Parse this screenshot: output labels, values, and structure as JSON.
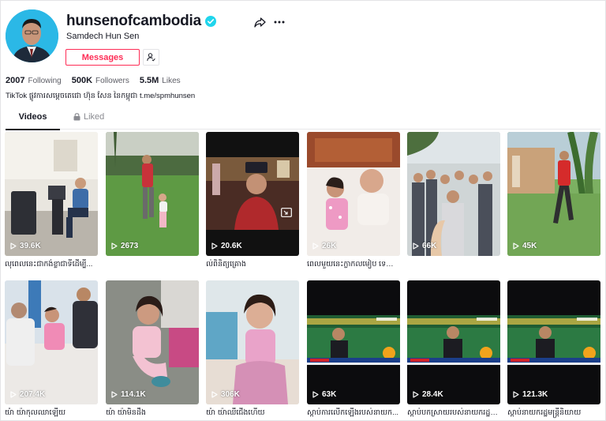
{
  "profile": {
    "username": "hunsenofcambodia",
    "display_name": "Samdech Hun Sen",
    "messages_label": "Messages",
    "bio": "TikTok ផ្លូវការសម្តេចតេជោ ហ៊ុន សែន នៃកម្ពុជា t.me/spmhunsen"
  },
  "stats": {
    "following": {
      "value": "2007",
      "label": "Following"
    },
    "followers": {
      "value": "500K",
      "label": "Followers"
    },
    "likes": {
      "value": "5.5M",
      "label": "Likes"
    }
  },
  "tabs": {
    "videos": "Videos",
    "liked": "Liked"
  },
  "videos": [
    {
      "views": "39.6K",
      "caption": "លុពេលនេះជាកង់ខ្លាជាទីដើម្បី..."
    },
    {
      "views": "2673",
      "caption": ""
    },
    {
      "views": "20.6K",
      "caption": "ល់ពិនិត្យគ្រោង"
    },
    {
      "views": "26K",
      "caption": "ពេលមួយនេះក្លាកលមៀប ទេស ពិតុ..."
    },
    {
      "views": "66K",
      "caption": ""
    },
    {
      "views": "45K",
      "caption": ""
    },
    {
      "views": "207.4K",
      "caption": "យ៉ា យ៉ាកុលឈាឡើយ"
    },
    {
      "views": "114.1K",
      "caption": "យ៉ា យ៉ាមិនដឹង"
    },
    {
      "views": "306K",
      "caption": "យ៉ា យ៉ាឈឺជើងហើយ"
    },
    {
      "views": "63K",
      "caption": "ស្តាប់ការលើកឡើងរបស់នាយក..."
    },
    {
      "views": "28.4K",
      "caption": "ស្តាប់បកស្រាយរបស់នាយករដ្ឋម..."
    },
    {
      "views": "121.3K",
      "caption": "ស្តាប់នាយករដ្ឋមន្ត្រីនិយាយ"
    }
  ],
  "colors": {
    "accent": "#fe2c55",
    "verified": "#20d5ec",
    "text": "#161823",
    "muted": "#5d5e66"
  }
}
